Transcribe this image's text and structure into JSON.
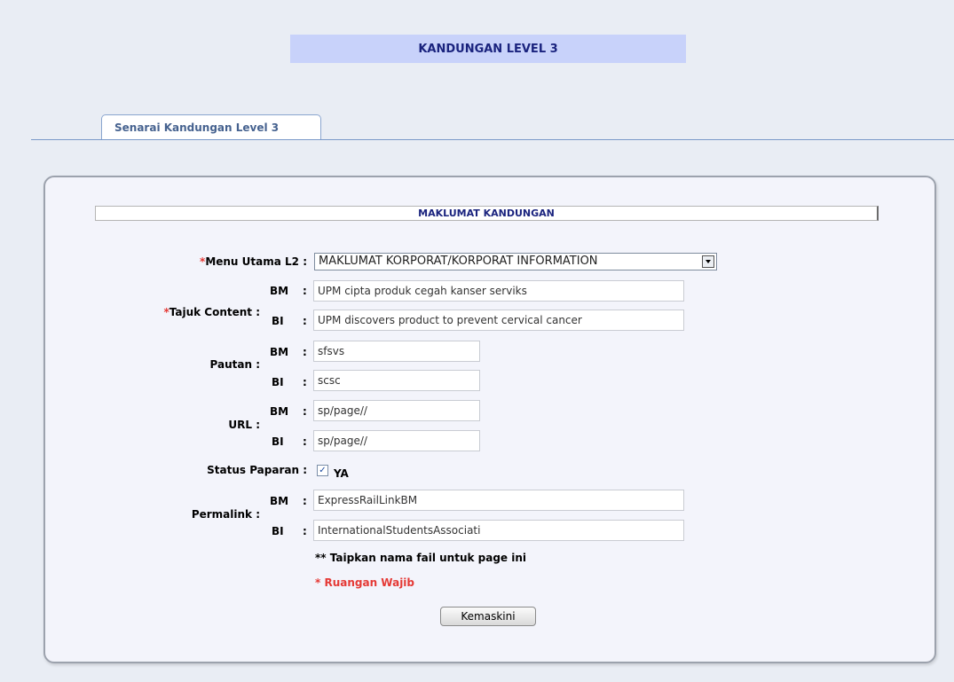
{
  "page": {
    "title": "KANDUNGAN LEVEL 3",
    "tab_label": "Senarai Kandungan Level 3",
    "section_title": "MAKLUMAT KANDUNGAN"
  },
  "form": {
    "required_mark": "*",
    "colon": ":",
    "bm": "BM",
    "bi": "BI",
    "menu_utama": {
      "label": "Menu Utama L2 :",
      "selected": "MAKLUMAT KORPORAT/KORPORAT INFORMATION"
    },
    "tajuk": {
      "label": "Tajuk Content :",
      "bm_value": "UPM cipta produk cegah kanser serviks",
      "bi_value": "UPM discovers product to prevent cervical cancer"
    },
    "pautan": {
      "label": "Pautan :",
      "bm_value": "sfsvs",
      "bi_value": "scsc"
    },
    "url": {
      "label": "URL :",
      "bm_value": "sp/page//",
      "bi_value": "sp/page//"
    },
    "status": {
      "label": "Status Paparan :",
      "option_label": "YA",
      "checked": true,
      "check_glyph": "✓"
    },
    "permalink": {
      "label": "Permalink :",
      "bm_value": "ExpressRailLinkBM",
      "bi_value": "InternationalStudentsAssociati"
    },
    "note_stars": "**",
    "note_text": "Taipkan nama fail untuk page ini",
    "required_note": "* Ruangan Wajib",
    "submit_label": "Kemaskini"
  },
  "colors": {
    "title_bg": "#c8d2fa",
    "accent_text": "#1a237e",
    "required": "#e53935"
  }
}
